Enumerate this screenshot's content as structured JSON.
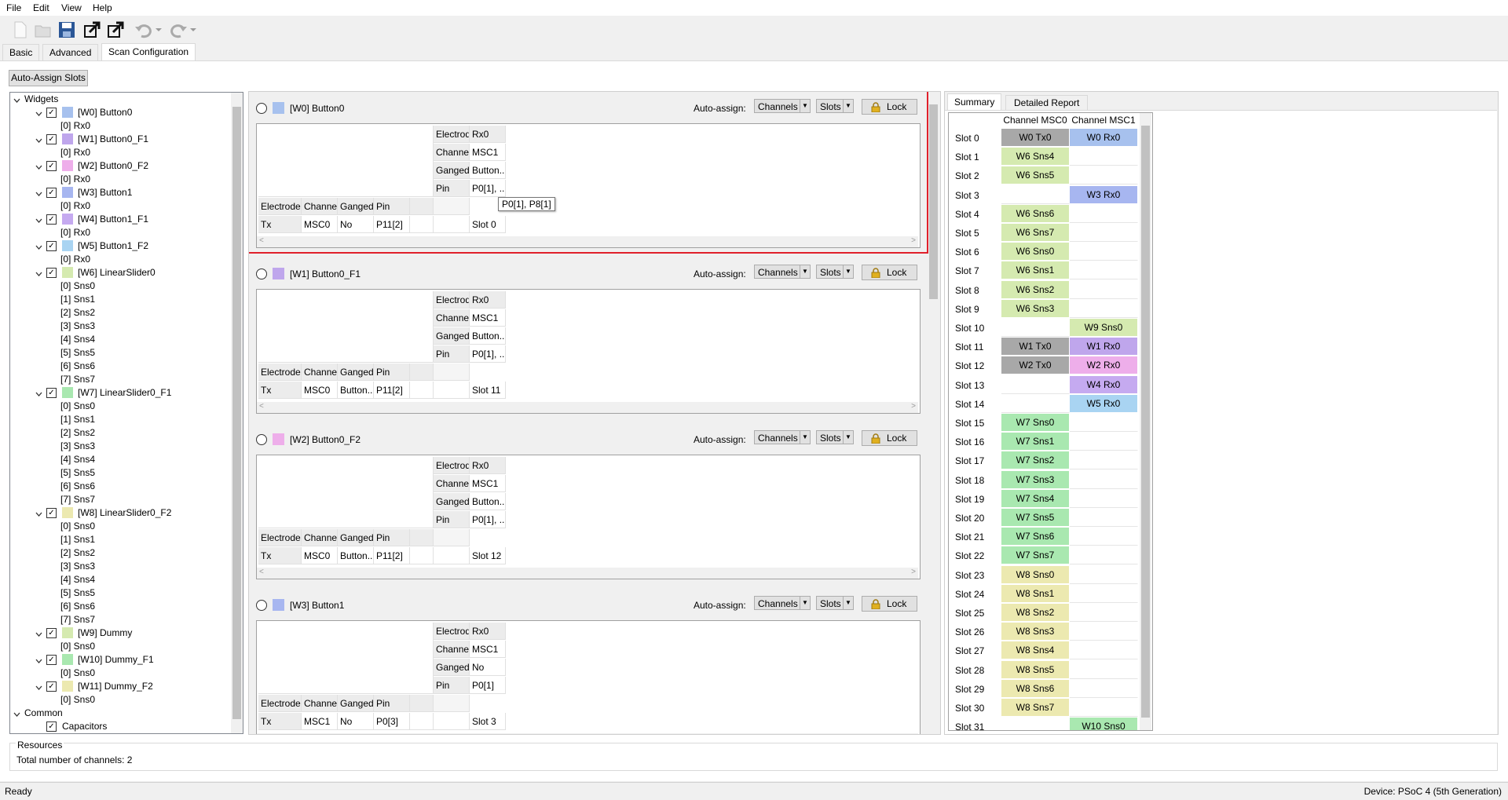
{
  "menu": [
    "File",
    "Edit",
    "View",
    "Help"
  ],
  "tabs": [
    "Basic",
    "Advanced",
    "Scan Configuration"
  ],
  "auto_assign_slots_label": "Auto-Assign Slots",
  "tree": {
    "root": "Widgets",
    "widgets": [
      {
        "label": "[W0] Button0",
        "color": "#a7c1ee",
        "children": [
          "[0] Rx0"
        ]
      },
      {
        "label": "[W1] Button0_F1",
        "color": "#bfa6ec",
        "children": [
          "[0] Rx0"
        ]
      },
      {
        "label": "[W2] Button0_F2",
        "color": "#eeaeea",
        "children": [
          "[0] Rx0"
        ]
      },
      {
        "label": "[W3] Button1",
        "color": "#a7b6f0",
        "children": [
          "[0] Rx0"
        ]
      },
      {
        "label": "[W4] Button1_F1",
        "color": "#c5aaf0",
        "children": [
          "[0] Rx0"
        ]
      },
      {
        "label": "[W5] Button1_F2",
        "color": "#a9d4f2",
        "children": [
          "[0] Rx0"
        ]
      },
      {
        "label": "[W6] LinearSlider0",
        "color": "#d5eab0",
        "children": [
          "[0] Sns0",
          "[1] Sns1",
          "[2] Sns2",
          "[3] Sns3",
          "[4] Sns4",
          "[5] Sns5",
          "[6] Sns6",
          "[7] Sns7"
        ]
      },
      {
        "label": "[W7] LinearSlider0_F1",
        "color": "#a9e8b0",
        "children": [
          "[0] Sns0",
          "[1] Sns1",
          "[2] Sns2",
          "[3] Sns3",
          "[4] Sns4",
          "[5] Sns5",
          "[6] Sns6",
          "[7] Sns7"
        ]
      },
      {
        "label": "[W8] LinearSlider0_F2",
        "color": "#ece9b0",
        "children": [
          "[0] Sns0",
          "[1] Sns1",
          "[2] Sns2",
          "[3] Sns3",
          "[4] Sns4",
          "[5] Sns5",
          "[6] Sns6",
          "[7] Sns7"
        ]
      },
      {
        "label": "[W9] Dummy",
        "color": "#d5eab0",
        "children": [
          "[0] Sns0"
        ]
      },
      {
        "label": "[W10] Dummy_F1",
        "color": "#a9e8b0",
        "children": [
          "[0] Sns0"
        ]
      },
      {
        "label": "[W11] Dummy_F2",
        "color": "#ece9b0",
        "children": [
          "[0] Sns0"
        ]
      }
    ],
    "common": "Common",
    "common_children": [
      "Capacitors"
    ]
  },
  "sections": [
    {
      "title": "[W0] Button0",
      "color": "#a7c1ee",
      "rx": {
        "electrode": "Rx0",
        "channel": "MSC1",
        "ganged": "Button...",
        "pin": "P0[1], ..."
      },
      "tx": {
        "electrode": "Tx",
        "channel": "MSC0",
        "ganged": "No",
        "pin": "P11[2]",
        "slot": "Slot 0"
      }
    },
    {
      "title": "[W1] Button0_F1",
      "color": "#bfa6ec",
      "rx": {
        "electrode": "Rx0",
        "channel": "MSC1",
        "ganged": "Button...",
        "pin": "P0[1], ..."
      },
      "tx": {
        "electrode": "Tx",
        "channel": "MSC0",
        "ganged": "Button...",
        "pin": "P11[2]",
        "slot": "Slot 11"
      }
    },
    {
      "title": "[W2] Button0_F2",
      "color": "#eeaeea",
      "rx": {
        "electrode": "Rx0",
        "channel": "MSC1",
        "ganged": "Button...",
        "pin": "P0[1], ..."
      },
      "tx": {
        "electrode": "Tx",
        "channel": "MSC0",
        "ganged": "Button...",
        "pin": "P11[2]",
        "slot": "Slot 12"
      }
    },
    {
      "title": "[W3] Button1",
      "color": "#a7b6f0",
      "rx": {
        "electrode": "Rx0",
        "channel": "MSC1",
        "ganged": "No",
        "pin": "P0[1]"
      },
      "tx": {
        "electrode": "Tx",
        "channel": "MSC1",
        "ganged": "No",
        "pin": "P0[3]",
        "slot": "Slot 3"
      }
    }
  ],
  "labels": {
    "electrode": "Electrode",
    "channel": "Channel",
    "ganged": "Ganged",
    "pin": "Pin",
    "auto_assign": "Auto-assign:",
    "channels": "Channels",
    "slots": "Slots",
    "lock": "Lock"
  },
  "tooltip": "P0[1], P8[1]",
  "summary": {
    "tabs": [
      "Summary",
      "Detailed Report"
    ],
    "col0": "Channel MSC0",
    "col1": "Channel MSC1",
    "rows": [
      {
        "slot": "Slot 0",
        "c0": "W0 Tx0",
        "c0color": "#a8a8a8",
        "c1": "W0 Rx0",
        "c1color": "#a7c1ee"
      },
      {
        "slot": "Slot 1",
        "c0": "W6 Sns4",
        "c0color": "#d5eab0",
        "c1": "",
        "c1color": ""
      },
      {
        "slot": "Slot 2",
        "c0": "W6 Sns5",
        "c0color": "#d5eab0",
        "c1": "",
        "c1color": ""
      },
      {
        "slot": "Slot 3",
        "c0": "",
        "c0color": "",
        "c1": "W3 Rx0",
        "c1color": "#a7b6f0"
      },
      {
        "slot": "Slot 4",
        "c0": "W6 Sns6",
        "c0color": "#d5eab0",
        "c1": "",
        "c1color": ""
      },
      {
        "slot": "Slot 5",
        "c0": "W6 Sns7",
        "c0color": "#d5eab0",
        "c1": "",
        "c1color": ""
      },
      {
        "slot": "Slot 6",
        "c0": "W6 Sns0",
        "c0color": "#d5eab0",
        "c1": "",
        "c1color": ""
      },
      {
        "slot": "Slot 7",
        "c0": "W6 Sns1",
        "c0color": "#d5eab0",
        "c1": "",
        "c1color": ""
      },
      {
        "slot": "Slot 8",
        "c0": "W6 Sns2",
        "c0color": "#d5eab0",
        "c1": "",
        "c1color": ""
      },
      {
        "slot": "Slot 9",
        "c0": "W6 Sns3",
        "c0color": "#d5eab0",
        "c1": "",
        "c1color": ""
      },
      {
        "slot": "Slot 10",
        "c0": "",
        "c0color": "",
        "c1": "W9 Sns0",
        "c1color": "#d5eab0"
      },
      {
        "slot": "Slot 11",
        "c0": "W1 Tx0",
        "c0color": "#a8a8a8",
        "c1": "W1 Rx0",
        "c1color": "#bfa6ec"
      },
      {
        "slot": "Slot 12",
        "c0": "W2 Tx0",
        "c0color": "#a8a8a8",
        "c1": "W2 Rx0",
        "c1color": "#eeaeea"
      },
      {
        "slot": "Slot 13",
        "c0": "",
        "c0color": "",
        "c1": "W4 Rx0",
        "c1color": "#c5aaf0"
      },
      {
        "slot": "Slot 14",
        "c0": "",
        "c0color": "",
        "c1": "W5 Rx0",
        "c1color": "#a9d4f2"
      },
      {
        "slot": "Slot 15",
        "c0": "W7 Sns0",
        "c0color": "#a9e8b0",
        "c1": "",
        "c1color": ""
      },
      {
        "slot": "Slot 16",
        "c0": "W7 Sns1",
        "c0color": "#a9e8b0",
        "c1": "",
        "c1color": ""
      },
      {
        "slot": "Slot 17",
        "c0": "W7 Sns2",
        "c0color": "#a9e8b0",
        "c1": "",
        "c1color": ""
      },
      {
        "slot": "Slot 18",
        "c0": "W7 Sns3",
        "c0color": "#a9e8b0",
        "c1": "",
        "c1color": ""
      },
      {
        "slot": "Slot 19",
        "c0": "W7 Sns4",
        "c0color": "#a9e8b0",
        "c1": "",
        "c1color": ""
      },
      {
        "slot": "Slot 20",
        "c0": "W7 Sns5",
        "c0color": "#a9e8b0",
        "c1": "",
        "c1color": ""
      },
      {
        "slot": "Slot 21",
        "c0": "W7 Sns6",
        "c0color": "#a9e8b0",
        "c1": "",
        "c1color": ""
      },
      {
        "slot": "Slot 22",
        "c0": "W7 Sns7",
        "c0color": "#a9e8b0",
        "c1": "",
        "c1color": ""
      },
      {
        "slot": "Slot 23",
        "c0": "W8 Sns0",
        "c0color": "#ece9b0",
        "c1": "",
        "c1color": ""
      },
      {
        "slot": "Slot 24",
        "c0": "W8 Sns1",
        "c0color": "#ece9b0",
        "c1": "",
        "c1color": ""
      },
      {
        "slot": "Slot 25",
        "c0": "W8 Sns2",
        "c0color": "#ece9b0",
        "c1": "",
        "c1color": ""
      },
      {
        "slot": "Slot 26",
        "c0": "W8 Sns3",
        "c0color": "#ece9b0",
        "c1": "",
        "c1color": ""
      },
      {
        "slot": "Slot 27",
        "c0": "W8 Sns4",
        "c0color": "#ece9b0",
        "c1": "",
        "c1color": ""
      },
      {
        "slot": "Slot 28",
        "c0": "W8 Sns5",
        "c0color": "#ece9b0",
        "c1": "",
        "c1color": ""
      },
      {
        "slot": "Slot 29",
        "c0": "W8 Sns6",
        "c0color": "#ece9b0",
        "c1": "",
        "c1color": ""
      },
      {
        "slot": "Slot 30",
        "c0": "W8 Sns7",
        "c0color": "#ece9b0",
        "c1": "",
        "c1color": ""
      },
      {
        "slot": "Slot 31",
        "c0": "",
        "c0color": "",
        "c1": "W10 Sns0",
        "c1color": "#a9e8b0"
      }
    ]
  },
  "resources": {
    "title": "Resources",
    "text": "Total number of channels: 2"
  },
  "status": {
    "left": "Ready",
    "right": "Device: PSoC 4 (5th Generation)"
  },
  "colors": {
    "highlight_border": "#e0202b"
  }
}
